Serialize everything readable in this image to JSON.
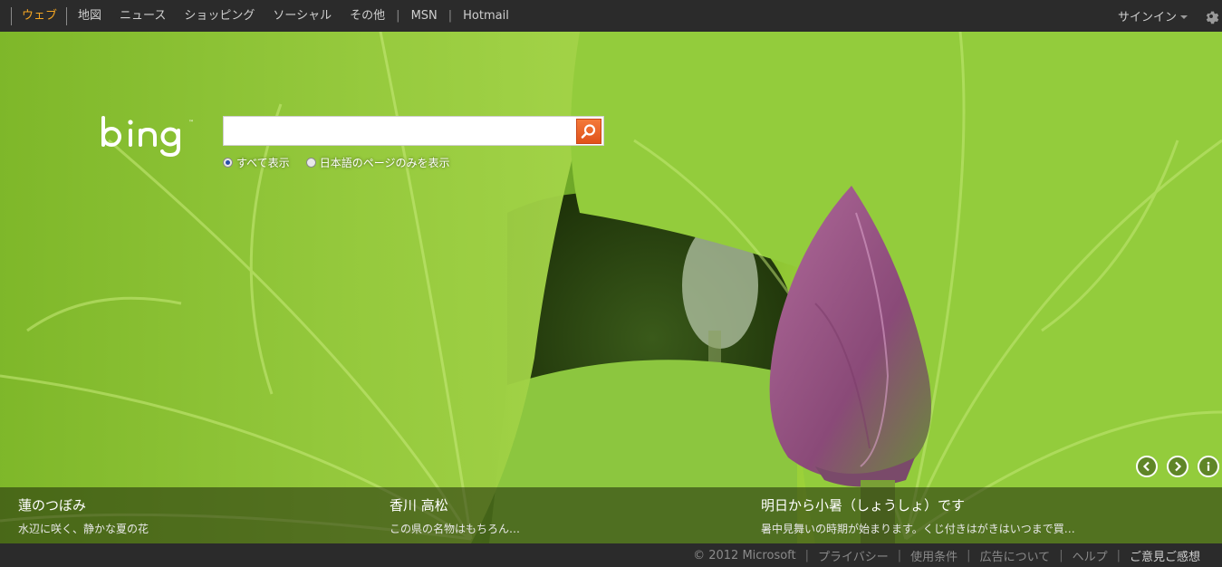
{
  "topbar": {
    "nav": [
      "ウェブ",
      "地図",
      "ニュース",
      "ショッピング",
      "ソーシャル",
      "その他"
    ],
    "links": [
      "MSN",
      "Hotmail"
    ],
    "signin": "サインイン"
  },
  "search": {
    "value": "",
    "scope_all": "すべて表示",
    "scope_ja": "日本語のページのみを表示"
  },
  "hotspots": [
    {
      "title": "蓮のつぼみ",
      "subtitle": "水辺に咲く、静かな夏の花"
    },
    {
      "title": "香川 高松",
      "subtitle": "この県の名物はもちろん…"
    },
    {
      "title": "明日から小暑（しょうしょ）です",
      "subtitle": "暑中見舞いの時期が始まります。くじ付きはがきはいつまで買…"
    }
  ],
  "footer": {
    "items": [
      "© 2012 Microsoft",
      "プライバシー",
      "使用条件",
      "広告について",
      "ヘルプ",
      "ご意見ご感想"
    ]
  },
  "colors": {
    "accent": "#f5a623",
    "search_button": "#e0521a",
    "bar": "#2b2b2b"
  },
  "icons": {
    "search": "magnifier-icon",
    "settings": "gear-icon",
    "prev": "chevron-left-icon",
    "next": "chevron-right-icon",
    "info": "info-icon"
  }
}
